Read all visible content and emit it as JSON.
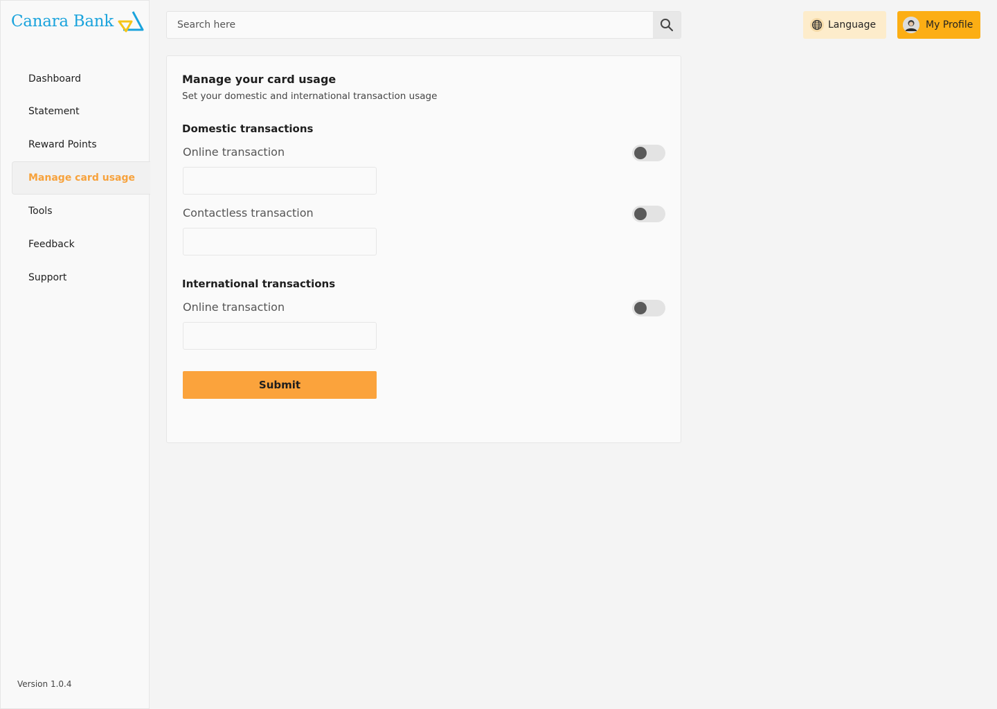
{
  "brand": {
    "name": "Canara Bank"
  },
  "sidebar": {
    "items": [
      {
        "label": "Dashboard"
      },
      {
        "label": "Statement"
      },
      {
        "label": "Reward Points"
      },
      {
        "label": "Manage card usage",
        "active": true
      },
      {
        "label": "Tools"
      },
      {
        "label": "Feedback"
      },
      {
        "label": "Support"
      }
    ],
    "version": "Version 1.0.4"
  },
  "header": {
    "search": {
      "placeholder": "Search here",
      "value": ""
    },
    "language_label": "Language",
    "profile_label": "My Profile"
  },
  "card": {
    "title": "Manage your card usage",
    "subtitle": "Set your domestic and international transaction usage",
    "domestic": {
      "title": "Domestic transactions",
      "online_label": "Online transaction",
      "online_enabled": false,
      "online_value": "",
      "contactless_label": "Contactless transaction",
      "contactless_enabled": false,
      "contactless_value": ""
    },
    "international": {
      "title": "International transactions",
      "online_label": "Online transaction",
      "online_enabled": false,
      "online_value": ""
    },
    "submit_label": "Submit"
  },
  "colors": {
    "brand_blue": "#1aa3dc",
    "accent_orange": "#fba33c",
    "profile_yellow": "#fcae14",
    "language_bg": "#fdeccb",
    "active_nav_text": "#f7a23c"
  },
  "icons": {
    "search": "search-icon",
    "language": "globe-icon",
    "profile": "avatar",
    "logo": "canara-logo-mark"
  }
}
